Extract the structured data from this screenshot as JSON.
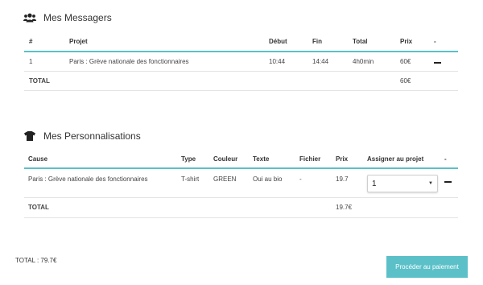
{
  "messagers": {
    "title": "Mes Messagers",
    "icon": "users-icon",
    "headers": {
      "num": "#",
      "projet": "Projet",
      "debut": "Début",
      "fin": "Fin",
      "total": "Total",
      "prix": "Prix",
      "action": "-"
    },
    "rows": [
      {
        "num": "1",
        "projet": "Paris : Grève nationale des fonctionnaires",
        "debut": "10:44",
        "fin": "14:44",
        "total": "4h0min",
        "prix": "60€"
      }
    ],
    "total_label": "TOTAL",
    "total_value": "60€"
  },
  "personnalisations": {
    "title": "Mes Personnalisations",
    "icon": "tshirt-icon",
    "headers": {
      "cause": "Cause",
      "type": "Type",
      "couleur": "Couleur",
      "texte": "Texte",
      "fichier": "Fichier",
      "prix": "Prix",
      "assigner": "Assigner au projet",
      "action": "-"
    },
    "rows": [
      {
        "cause": "Paris : Grève nationale des fonctionnaires",
        "type": "T-shirt",
        "couleur": "GREEN",
        "texte": "Oui au bio",
        "fichier": "-",
        "prix": "19.7",
        "assigner": "1"
      }
    ],
    "total_label": "TOTAL",
    "total_value": "19.7€"
  },
  "footer": {
    "grand_total": "TOTAL : 79.7€",
    "pay_button": "Procéder au paiement"
  },
  "colors": {
    "accent": "#5bc0c8"
  }
}
